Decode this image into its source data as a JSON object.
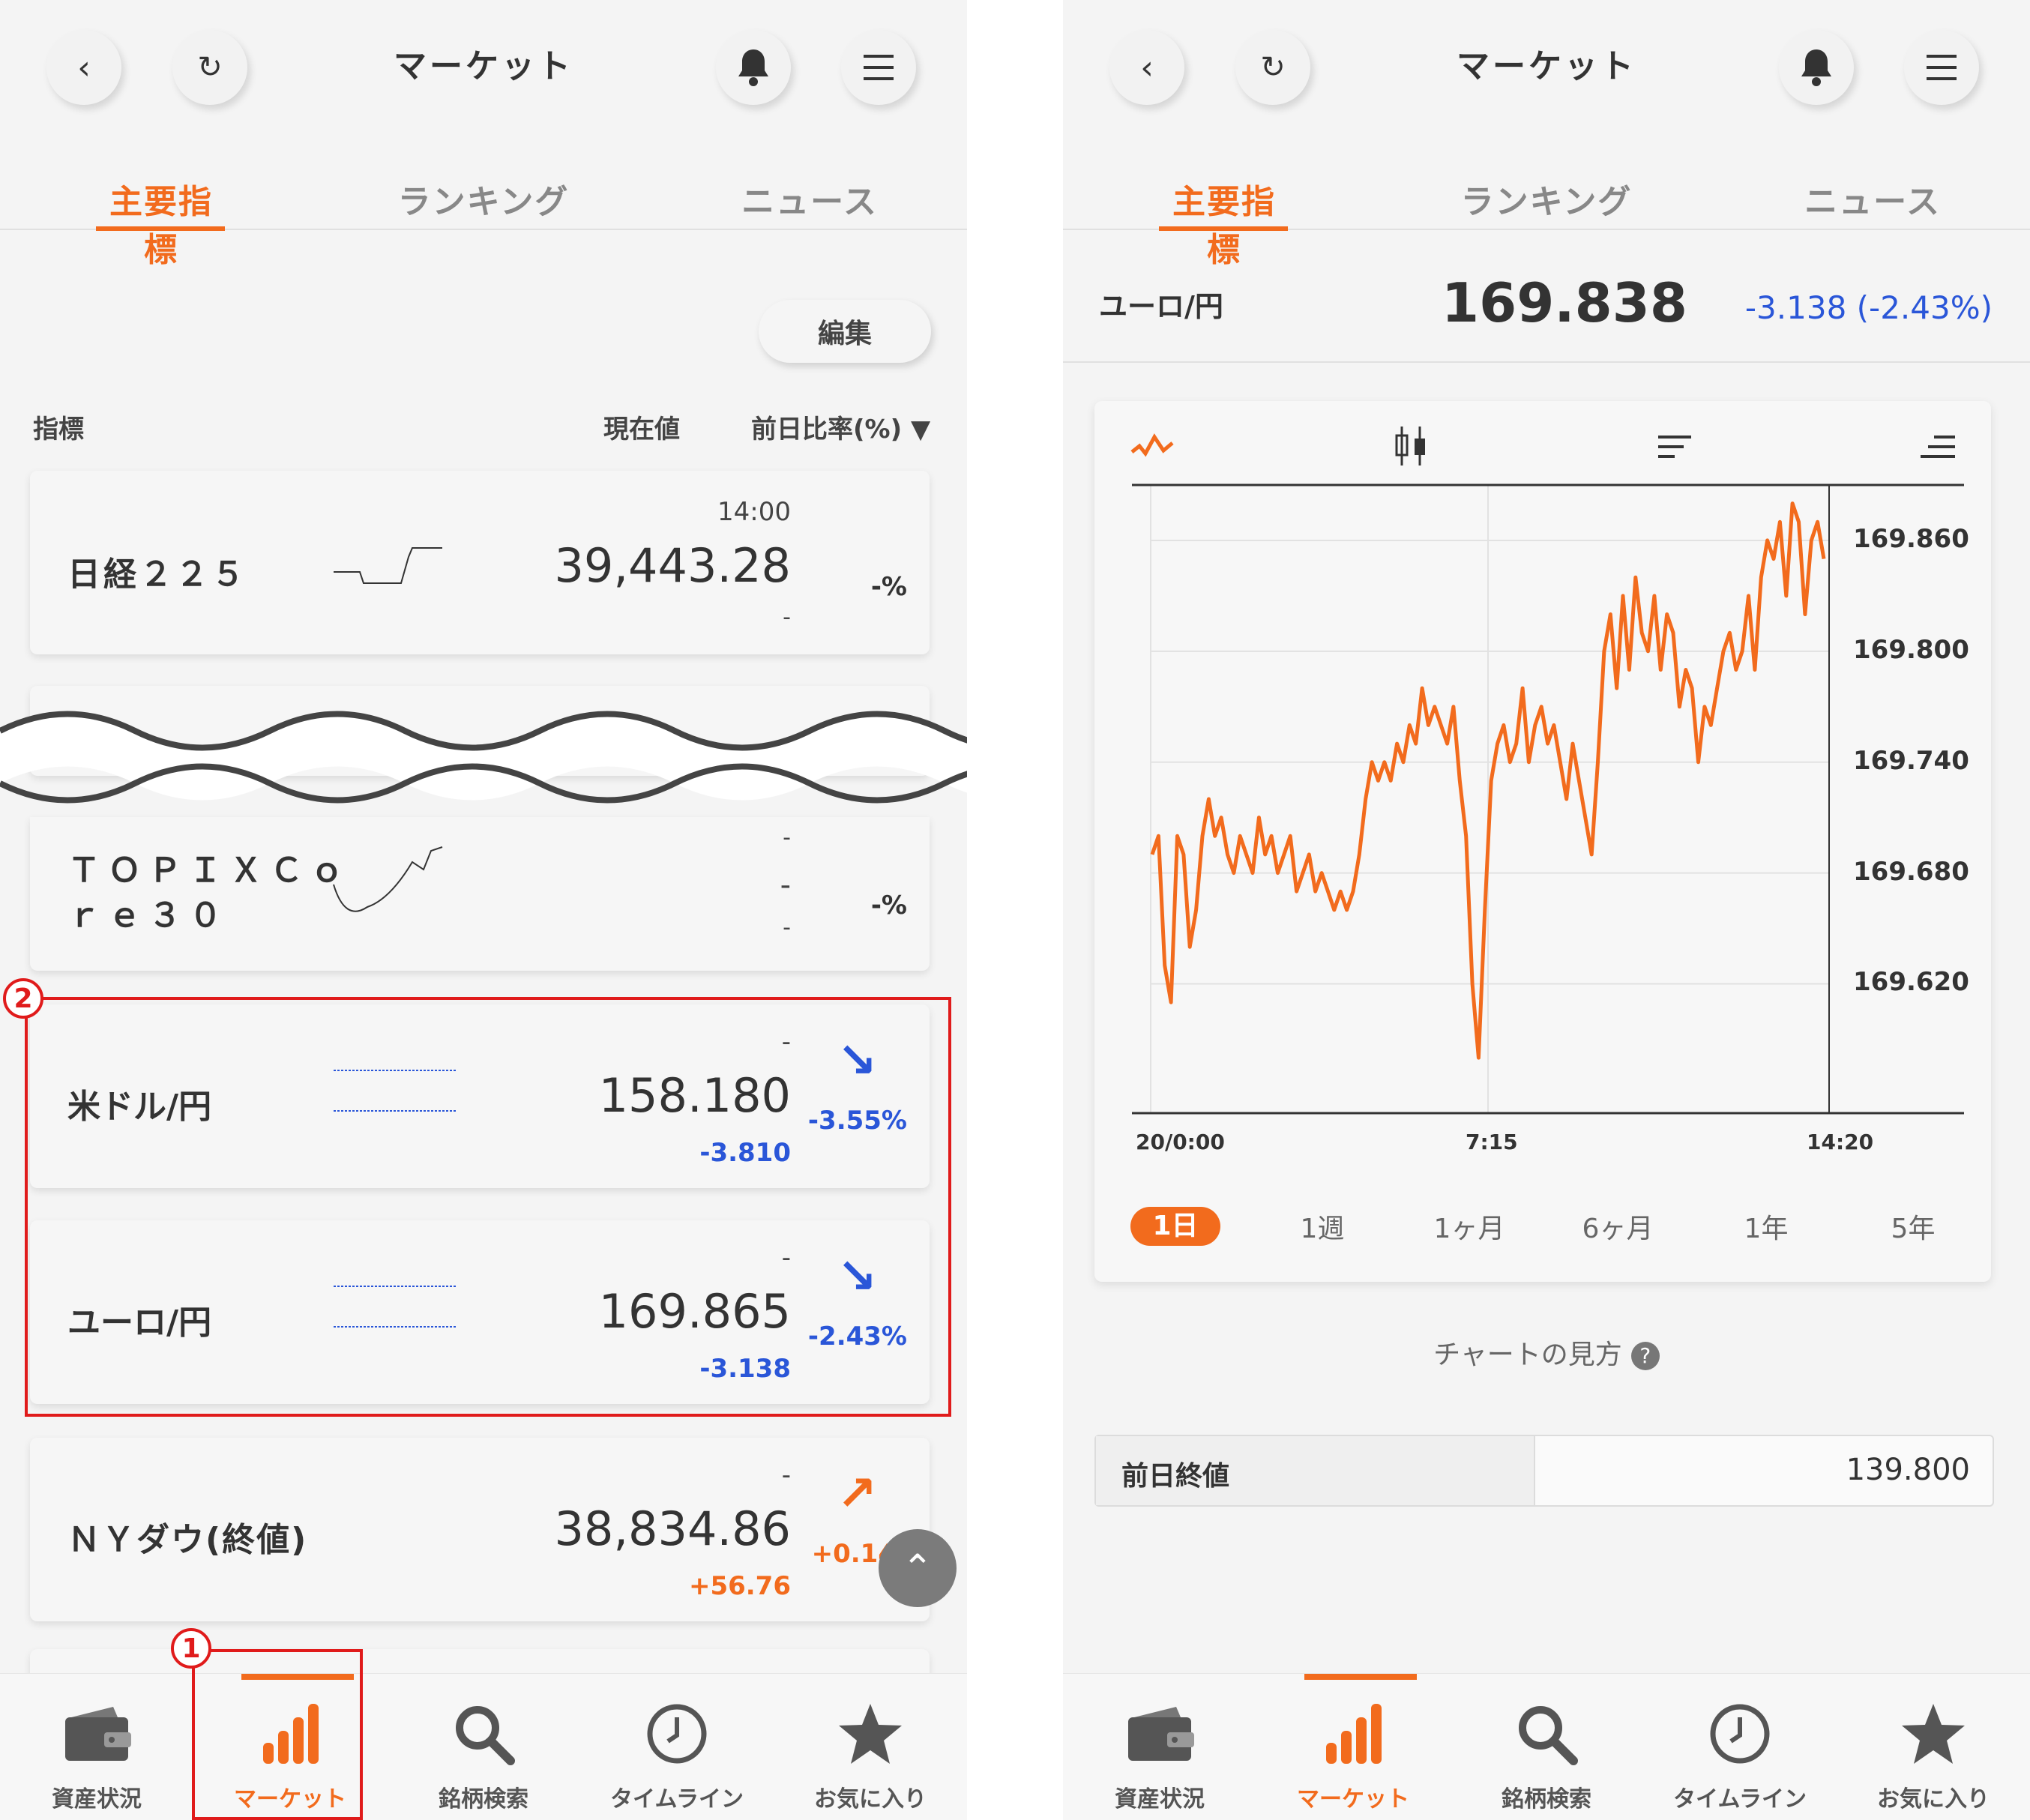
{
  "header": {
    "title": "マーケット"
  },
  "tabs": [
    "主要指標",
    "ランキング",
    "ニュース"
  ],
  "edit_label": "編集",
  "columns": {
    "indicator": "指標",
    "current": "現在値",
    "change": "前日比率(%) ▼"
  },
  "cards": {
    "nikkei": {
      "name": "日経２２５",
      "time": "14:00",
      "value": "39,443.28",
      "change": "-",
      "pct": "-%"
    },
    "topix": {
      "name_line1": "ＴＯＰＩＸＣｏ",
      "name_line2": "ｒｅ３０",
      "dash1": "-",
      "value": "-",
      "dash2": "-",
      "pct": "-%"
    },
    "usdjpy": {
      "name": "米ドル/円",
      "time": "-",
      "value": "158.180",
      "change": "-3.810",
      "pct": "-3.55%",
      "arrow": "↘"
    },
    "eurjpy": {
      "name": "ユーロ/円",
      "time": "-",
      "value": "169.865",
      "change": "-3.138",
      "pct": "-2.43%",
      "arrow": "↘"
    },
    "nydow": {
      "name": "ＮＹダウ(終値)",
      "time": "-",
      "value": "38,834.86",
      "change": "+56.76",
      "pct": "+0.14",
      "arrow": "↗"
    }
  },
  "markers": {
    "one": "1",
    "two": "2"
  },
  "nav": [
    "資産状況",
    "マーケット",
    "銘柄検索",
    "タイムライン",
    "お気に入り"
  ],
  "detail": {
    "pair": "ユーロ/円",
    "value": "169.838",
    "change": "-3.138 (-2.43%)",
    "periods": [
      "1日",
      "1週",
      "1ヶ月",
      "6ヶ月",
      "1年",
      "5年"
    ],
    "howto": "チャートの見方",
    "prev_label": "前日終値",
    "prev_value": "139.800"
  },
  "chart_data": {
    "type": "line",
    "title": "",
    "xlabel": "",
    "ylabel": "",
    "x_ticks": [
      "20/0:00",
      "7:15",
      "14:20"
    ],
    "y_ticks": [
      169.86,
      169.8,
      169.74,
      169.68,
      169.62
    ],
    "ylim": [
      169.55,
      169.89
    ],
    "color": "#f26b1d",
    "series": [
      {
        "values": [
          169.69,
          169.7,
          169.63,
          169.61,
          169.7,
          169.69,
          169.64,
          169.66,
          169.7,
          169.72,
          169.7,
          169.71,
          169.69,
          169.68,
          169.7,
          169.69,
          169.68,
          169.71,
          169.69,
          169.7,
          169.68,
          169.69,
          169.7,
          169.67,
          169.68,
          169.69,
          169.67,
          169.68,
          169.67,
          169.66,
          169.67,
          169.66,
          169.67,
          169.69,
          169.72,
          169.74,
          169.73,
          169.74,
          169.73,
          169.75,
          169.74,
          169.76,
          169.75,
          169.78,
          169.76,
          169.77,
          169.76,
          169.75,
          169.77,
          169.73,
          169.7,
          169.62,
          169.58,
          169.66,
          169.73,
          169.75,
          169.76,
          169.74,
          169.75,
          169.78,
          169.74,
          169.76,
          169.77,
          169.75,
          169.76,
          169.74,
          169.72,
          169.75,
          169.73,
          169.71,
          169.69,
          169.74,
          169.8,
          169.82,
          169.78,
          169.83,
          169.79,
          169.84,
          169.81,
          169.8,
          169.83,
          169.79,
          169.82,
          169.81,
          169.77,
          169.79,
          169.78,
          169.74,
          169.77,
          169.76,
          169.78,
          169.8,
          169.81,
          169.79,
          169.8,
          169.83,
          169.79,
          169.84,
          169.86,
          169.85,
          169.87,
          169.83,
          169.88,
          169.87,
          169.82,
          169.86,
          169.87,
          169.85
        ]
      }
    ]
  }
}
